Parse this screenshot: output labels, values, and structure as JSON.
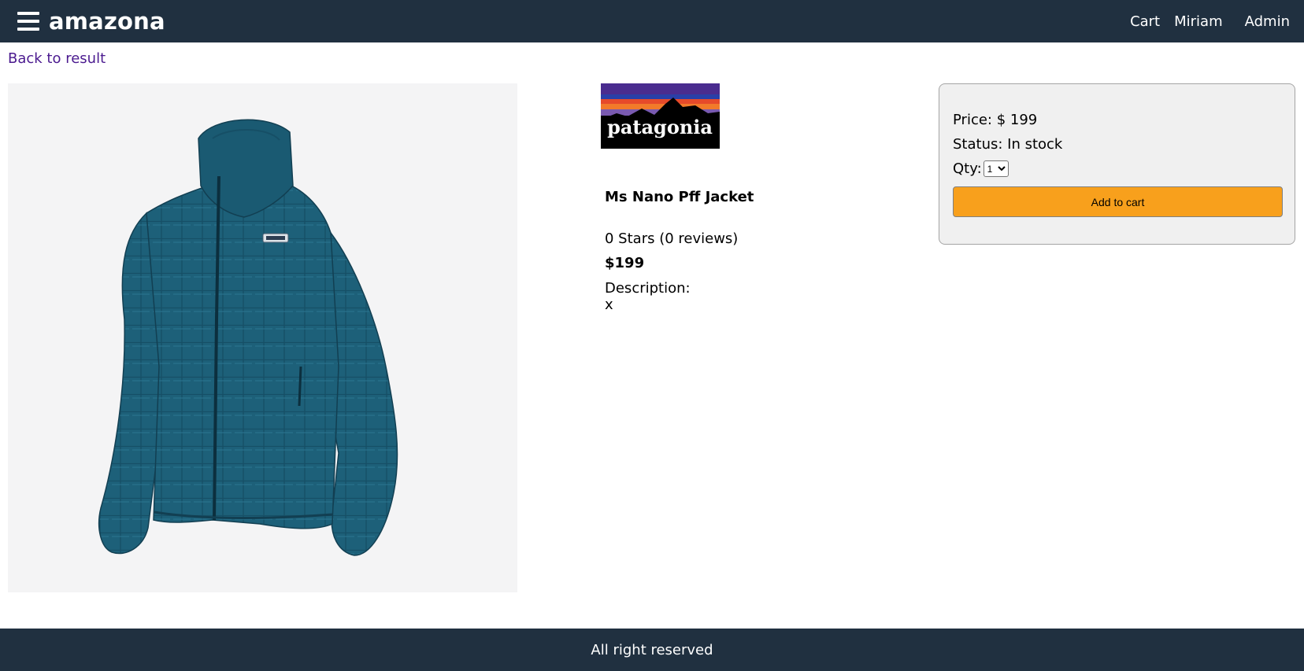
{
  "header": {
    "brand": "amazona",
    "nav": {
      "cart": "Cart",
      "user": "Miriam",
      "admin": "Admin"
    }
  },
  "back_link": "Back to result",
  "product": {
    "brand_logo_text": "patagonia",
    "name": "Ms Nano Pff Jacket",
    "rating": "0 Stars (0 reviews)",
    "price": "$199",
    "description_label": "Description:",
    "description": "x"
  },
  "purchase": {
    "price": "Price: $ 199",
    "status": "Status: In stock",
    "qty_label": "Qty:",
    "qty_selected": "1",
    "add_button": "Add to cart"
  },
  "footer": {
    "text": "All right reserved"
  },
  "colors": {
    "header_bg": "#203040",
    "button_bg": "#f8a01c",
    "link": "#4b1a8f"
  }
}
